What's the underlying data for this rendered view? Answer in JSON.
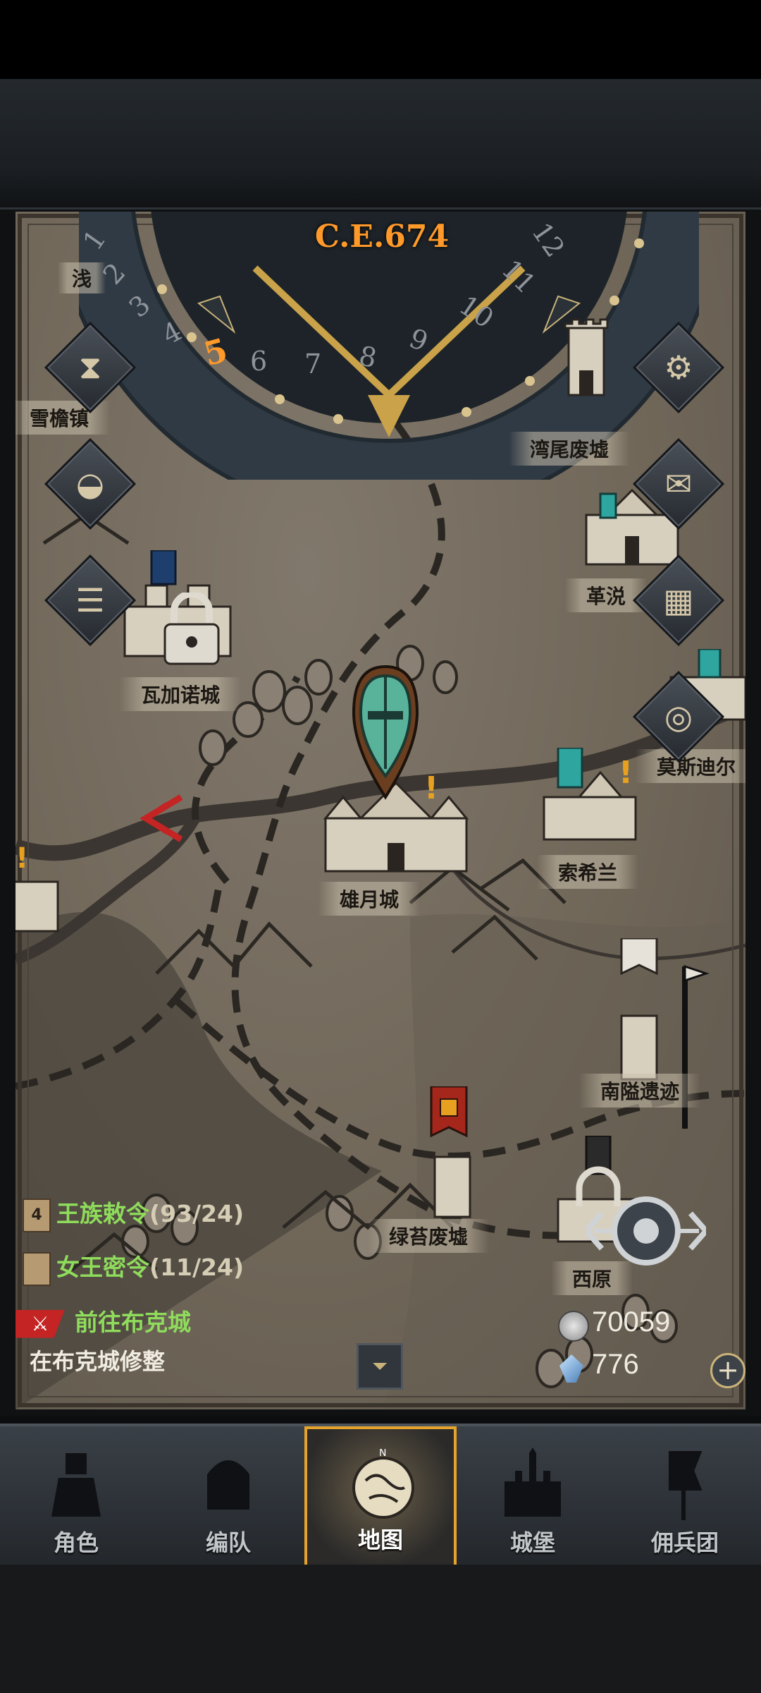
{
  "calendar": {
    "era": "C.E.674",
    "months": [
      "1",
      "2",
      "3",
      "4",
      "5",
      "6",
      "7",
      "8",
      "9",
      "10",
      "11",
      "12"
    ],
    "current_month": "5"
  },
  "towns": {
    "xueyan": "雪檐镇",
    "waner": "湾尾废墟",
    "gejue": "革涚",
    "wajianuo": "瓦加诺城",
    "mosidi": "莫斯迪尔",
    "xiongyue": "雄月城",
    "suoxilan": "索希兰",
    "nanai": "南隘遗迹",
    "lvtai": "绿苔废墟",
    "xiyuan": "西原",
    "top_partial": "浅"
  },
  "quests": [
    {
      "name": "王族敕令",
      "count": "(93/24)",
      "badge": "4"
    },
    {
      "name": "女王密令",
      "count": "(11/24)"
    }
  ],
  "march": {
    "destination": "前往布克城",
    "status": "在布克城修整"
  },
  "currency": {
    "silver": "70059",
    "crystal": "776"
  },
  "nav": [
    {
      "label": "角色"
    },
    {
      "label": "编队"
    },
    {
      "label": "地图"
    },
    {
      "label": "城堡"
    },
    {
      "label": "佣兵团"
    }
  ],
  "colors": {
    "accent": "#e6a32c",
    "quest_green": "#8fdc5c",
    "era_orange": "#ff9a2a"
  }
}
